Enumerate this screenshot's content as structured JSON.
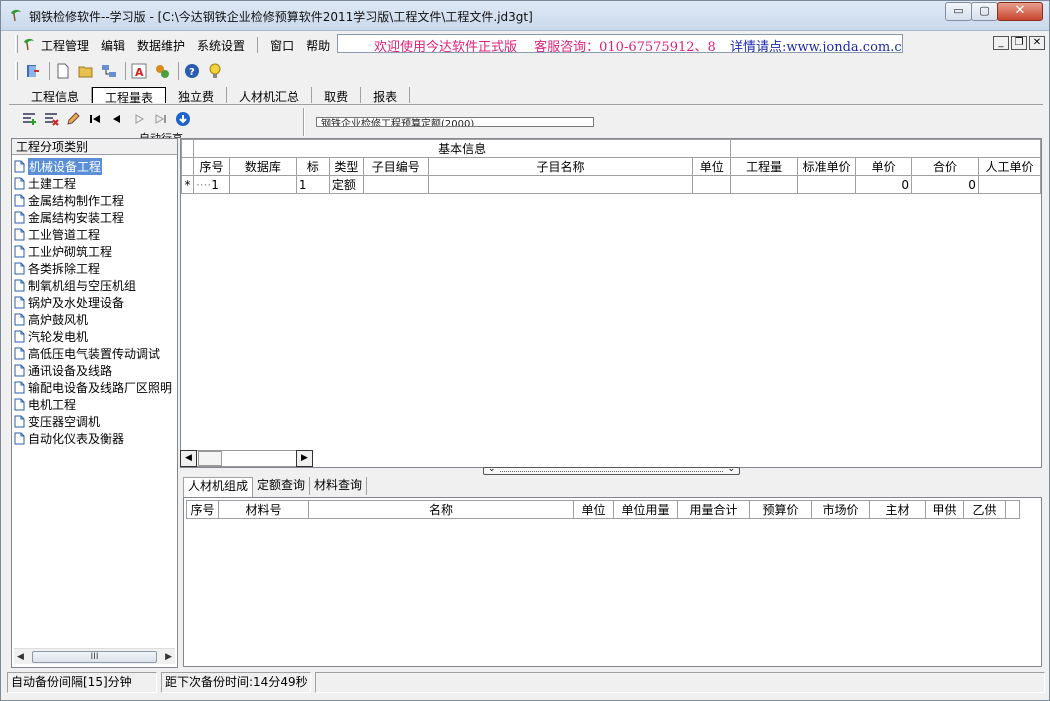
{
  "window": {
    "title": "钢铁检修软件--学习版 - [C:\\今达钢铁企业检修预算软件2011学习版\\工程文件\\工程文件.jd3gt]",
    "controls": {
      "minimize": "▭",
      "maximize": "▢",
      "close": "✕"
    }
  },
  "menubar": {
    "items": [
      "工程管理",
      "编辑",
      "数据维护",
      "系统设置",
      "窗口",
      "帮助"
    ],
    "banner_text": "欢迎使用今达软件正式版　 客服咨询：010-67575912、8",
    "banner_link": "详情请点:www.jonda.com.cn",
    "mdi": {
      "minimize": "_",
      "restore": "❐",
      "close": "✕"
    }
  },
  "toolbar": {
    "icons": [
      "exit-icon",
      "new-file-icon",
      "open-folder-icon",
      "network-icon",
      "text-a-icon",
      "plugin-icon",
      "help-icon",
      "tip-bulb-icon"
    ]
  },
  "tabs": [
    {
      "label": "工程信息",
      "active": false
    },
    {
      "label": "工程量表",
      "active": true
    },
    {
      "label": "独立费",
      "active": false
    },
    {
      "label": "人材机汇总",
      "active": false
    },
    {
      "label": "取费",
      "active": false
    },
    {
      "label": "报表",
      "active": false
    }
  ],
  "quota": {
    "selected": "钢铁企业检修工程预算定额(2000)",
    "auto_row": "自动行高"
  },
  "left_panel": {
    "header": "工程分项类别",
    "items": [
      "机械设备工程",
      "土建工程",
      "金属结构制作工程",
      "金属结构安装工程",
      "工业管道工程",
      "工业炉砌筑工程",
      "各类拆除工程",
      "制氧机组与空压机组",
      "锅炉及水处理设备",
      "高炉鼓风机",
      "汽轮发电机",
      "高低压电气装置传动调试",
      "通讯设备及线路",
      "输配电设备及线路厂区照明",
      "电机工程",
      "变压器空调机",
      "自动化仪表及衡器"
    ],
    "selected_index": 0,
    "scroll_thumb": "III"
  },
  "main_grid": {
    "group_header": "基本信息",
    "columns": [
      "序号",
      "数据库",
      "标",
      "类型",
      "子目编号",
      "子目名称",
      "单位",
      "工程量",
      "标准单价",
      "单价",
      "合价",
      "人工单价"
    ],
    "row": {
      "marker": "*",
      "seq": "1",
      "db": "",
      "flag": "1",
      "type": "定额",
      "code": "",
      "name": "",
      "unit": "",
      "qty": "",
      "std_price": "",
      "price": "0",
      "total": "0",
      "labor_price": ""
    }
  },
  "bottom_tabs": [
    {
      "label": "人材机组成",
      "active": true
    },
    {
      "label": "定额查询",
      "active": false
    },
    {
      "label": "材料查询",
      "active": false
    }
  ],
  "bottom_grid": {
    "columns": [
      "序号",
      "材料号",
      "名称",
      "单位",
      "单位用量",
      "用量合计",
      "预算价",
      "市场价",
      "主材",
      "甲供",
      "乙供"
    ]
  },
  "status": {
    "backup_interval": "自动备份间隔[15]分钟",
    "next_backup": "距下次备份时间:14分49秒"
  }
}
